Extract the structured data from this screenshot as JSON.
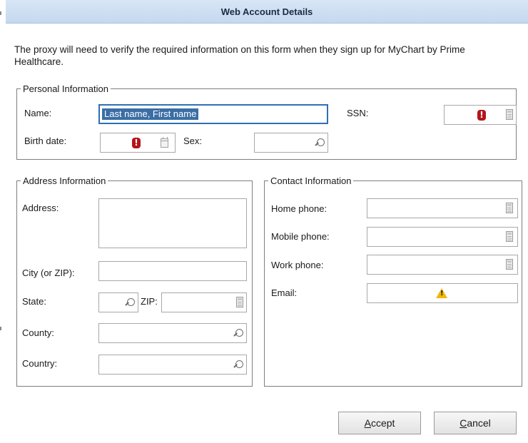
{
  "window": {
    "title": "Web Account Details"
  },
  "intro_text": "The proxy will need to verify the required information on this form when they sign up for MyChart by Prime Healthcare.",
  "personal": {
    "legend": "Personal Information",
    "name_label": "Name:",
    "name_value": "Last name, First name",
    "ssn_label": "SSN:",
    "birth_label": "Birth date:",
    "sex_label": "Sex:"
  },
  "address": {
    "legend": "Address Information",
    "address_label": "Address:",
    "city_label": "City (or ZIP):",
    "state_label": "State:",
    "zip_label": "ZIP:",
    "county_label": "County:",
    "country_label": "Country:"
  },
  "contact": {
    "legend": "Contact Information",
    "home_label": "Home phone:",
    "mobile_label": "Mobile phone:",
    "work_label": "Work phone:",
    "email_label": "Email:"
  },
  "icons": {
    "error_glyph": "!",
    "warning_glyph": "!"
  },
  "buttons": {
    "accept_mnemonic": "A",
    "accept_rest": "ccept",
    "cancel_mnemonic": "C",
    "cancel_rest": "ancel"
  },
  "colors": {
    "title_bar": "#c5d8ef",
    "focus_border": "#2f6fb3",
    "selection": "#3a6ea5",
    "error": "#b3151b",
    "warning": "#f2b705"
  }
}
